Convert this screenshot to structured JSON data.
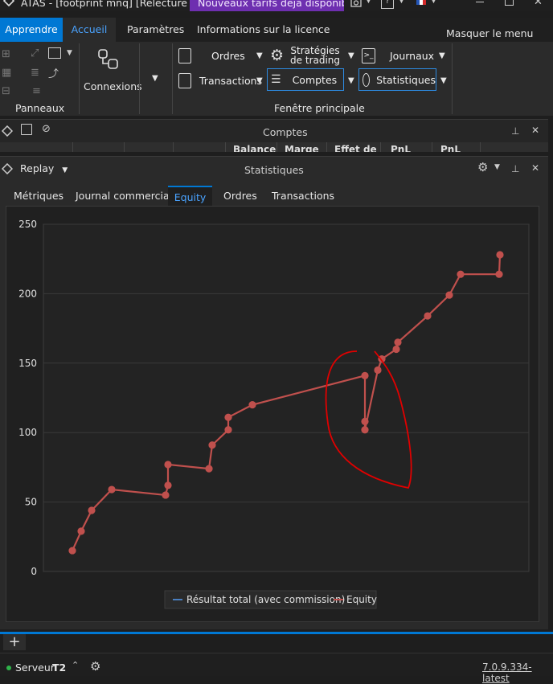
{
  "app": {
    "title": "ATAS - [footprint mnq] [Relecture act...",
    "promo_banner": "Nouveaux tarifs déjà disponibles"
  },
  "ribbon_tabs": {
    "apprendre": "Apprendre",
    "accueil": "Accueil",
    "parametres": "Paramètres",
    "licence": "Informations sur la licence",
    "hide_menu": "Masquer le menu"
  },
  "ribbon": {
    "panneaux_label": "Panneaux",
    "connexions_label": "Connexions",
    "fenetre_label": "Fenêtre principale",
    "buttons": {
      "ordres": "Ordres",
      "strategies_line1": "Stratégies",
      "strategies_line2": "de trading",
      "journaux": "Journaux",
      "transactions": "Transactions",
      "comptes": "Comptes",
      "statistiques": "Statistiques"
    }
  },
  "comptes_panel": {
    "title": "Comptes",
    "columns": [
      "Balance",
      "Marge",
      "Effet de",
      "PnL",
      "PnL"
    ]
  },
  "stats_panel": {
    "replay_label": "Replay",
    "title": "Statistiques",
    "tabs": [
      "Métriques",
      "Journal commercial",
      "Equity",
      "Ordres",
      "Transactions"
    ],
    "active_tab": "Equity"
  },
  "chart_data": {
    "type": "line",
    "ylim": [
      0,
      250
    ],
    "yticks": [
      0,
      50,
      100,
      150,
      200,
      250
    ],
    "grid": true,
    "legend_position": "bottom-center",
    "series": [
      {
        "name": "Résultat total (avec commission)",
        "color": "#4a7fc1",
        "values": []
      },
      {
        "name": "Equity",
        "color": "#c0504d",
        "values": [
          15,
          29,
          44,
          59,
          55,
          62,
          77,
          74,
          91,
          102,
          111,
          120,
          141,
          108,
          102,
          145,
          153,
          160,
          165,
          184,
          199,
          214,
          214,
          228
        ]
      }
    ],
    "annotation_color": "#e00000"
  },
  "status_bar": {
    "server_label": "Serveur:",
    "server_value": "T2",
    "version": "7.0.9.334-latest"
  },
  "colors": {
    "accent_blue": "#0078d4",
    "promo_purple": "#6e2fb0",
    "equity_red": "#c0504d"
  }
}
